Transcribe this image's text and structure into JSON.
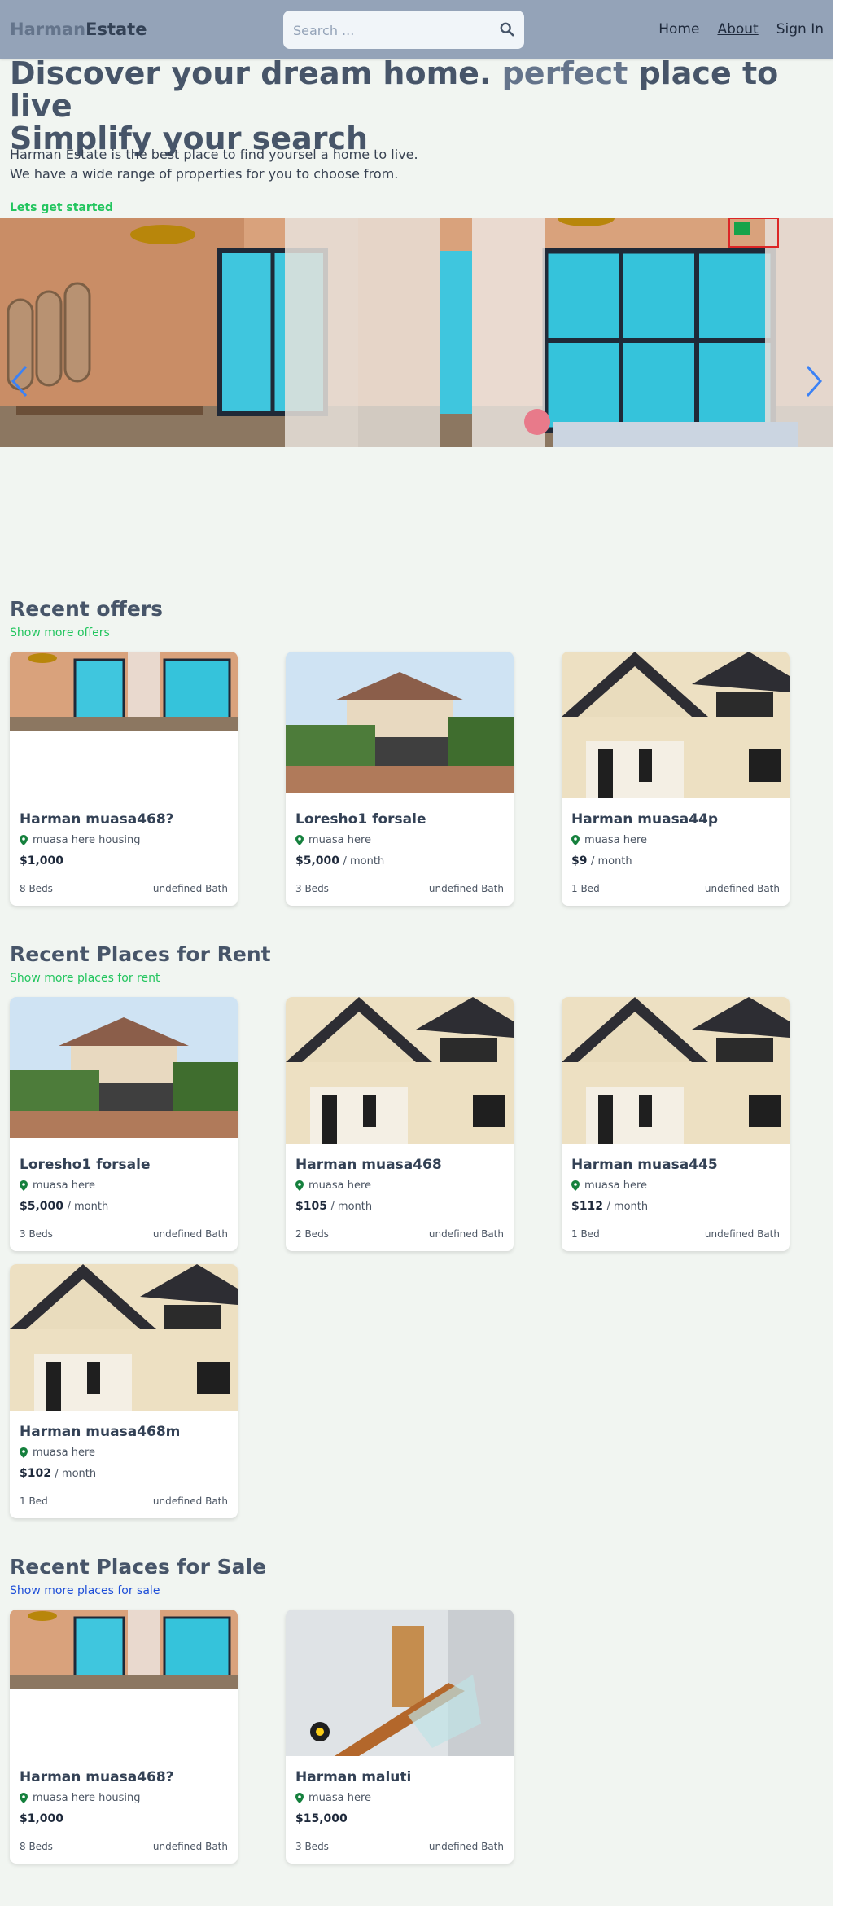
{
  "header": {
    "logo_part1": "Harman",
    "logo_part2": "Estate",
    "search_placeholder": "Search ...",
    "nav": {
      "home": "Home",
      "about": "About",
      "signin": "Sign In"
    }
  },
  "hero": {
    "title_part1": "Discover your dream home.",
    "title_accent": "perfect",
    "title_part2": "place to live",
    "title_line2": "Simplify your search",
    "desc_line1": "Harman Estate is the best place to find yoursel a home to live.",
    "desc_line2": "We have a wide range of properties for you to choose from.",
    "cta": "Lets get started"
  },
  "sections": {
    "offers": {
      "title": "Recent offers",
      "link": "Show more offers"
    },
    "rent": {
      "title": "Recent Places for Rent",
      "link": "Show more places for rent"
    },
    "sale": {
      "title": "Recent Places for Sale",
      "link": "Show more places for sale"
    }
  },
  "offers": [
    {
      "title": "Harman muasa468?",
      "location": "muasa here housing",
      "price": "$1,000",
      "per": "",
      "beds": "8 Beds",
      "bath": "undefined Bath",
      "image": "living-room"
    },
    {
      "title": "Loresho1 forsale",
      "location": "muasa here",
      "price": "$5,000",
      "per": "/ month",
      "beds": "3 Beds",
      "bath": "undefined Bath",
      "image": "house-gate"
    },
    {
      "title": "Harman muasa44p",
      "location": "muasa here",
      "price": "$9",
      "per": "/ month",
      "beds": "1 Bed",
      "bath": "undefined Bath",
      "image": "house-facade"
    }
  ],
  "rent": [
    {
      "title": "Loresho1 forsale",
      "location": "muasa here",
      "price": "$5,000",
      "per": "/ month",
      "beds": "3 Beds",
      "bath": "undefined Bath",
      "image": "house-gate"
    },
    {
      "title": "Harman muasa468",
      "location": "muasa here",
      "price": "$105",
      "per": "/ month",
      "beds": "2 Beds",
      "bath": "undefined Bath",
      "image": "house-facade"
    },
    {
      "title": "Harman muasa445",
      "location": "muasa here",
      "price": "$112",
      "per": "/ month",
      "beds": "1 Bed",
      "bath": "undefined Bath",
      "image": "house-facade"
    },
    {
      "title": "Harman muasa468m",
      "location": "muasa here",
      "price": "$102",
      "per": "/ month",
      "beds": "1 Bed",
      "bath": "undefined Bath",
      "image": "house-facade"
    }
  ],
  "sale": [
    {
      "title": "Harman muasa468?",
      "location": "muasa here housing",
      "price": "$1,000",
      "per": "",
      "beds": "8 Beds",
      "bath": "undefined Bath",
      "image": "living-room"
    },
    {
      "title": "Harman maluti",
      "location": "muasa here",
      "price": "$15,000",
      "per": "",
      "beds": "3 Beds",
      "bath": "undefined Bath",
      "image": "staircase"
    }
  ],
  "colors": {
    "header_bg": "#94a3b8",
    "accent_green": "#22c55e",
    "link_blue": "#1d4ed8",
    "page_bg": "#f1f5f1"
  }
}
